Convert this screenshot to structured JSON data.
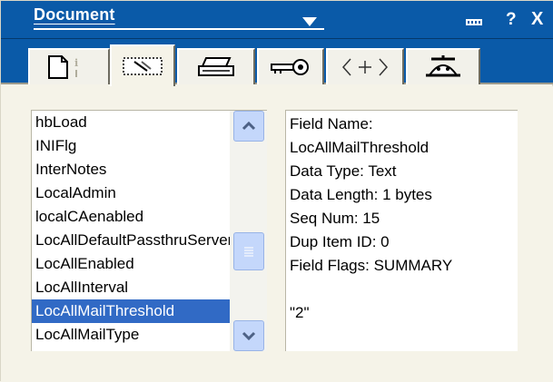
{
  "window": {
    "title": "Document",
    "buttons": {
      "minimize_icon": "minimize-bar-icon",
      "help_label": "?",
      "close_label": "X"
    }
  },
  "tabs": [
    {
      "icon": "document-info-icon"
    },
    {
      "icon": "field-list-icon"
    },
    {
      "icon": "printer-icon"
    },
    {
      "icon": "key-icon"
    },
    {
      "icon": "html-tag-icon"
    },
    {
      "icon": "beanie-hat-icon"
    }
  ],
  "field_list": {
    "items": [
      "hbLoad",
      "INIFlg",
      "InterNotes",
      "LocalAdmin",
      "localCAenabled",
      "LocAllDefaultPassthruServer",
      "LocAllEnabled",
      "LocAllInterval",
      "LocAllMailThreshold",
      "LocAllMailType"
    ],
    "selected_index": 8
  },
  "field_info": {
    "field_name_label": "Field Name:",
    "field_name": "LocAllMailThreshold",
    "data_type": "Data Type: Text",
    "data_length": "Data Length: 1 bytes",
    "seq_num": "Seq Num: 15",
    "dup_item_id": "Dup Item ID: 0",
    "field_flags": "Field Flags: SUMMARY",
    "value": "\"2\""
  },
  "colors": {
    "titlebar": "#0a5aa8",
    "selection": "#316ac5",
    "panel": "#f5f3e8",
    "scroll": "#c4d7fb"
  }
}
